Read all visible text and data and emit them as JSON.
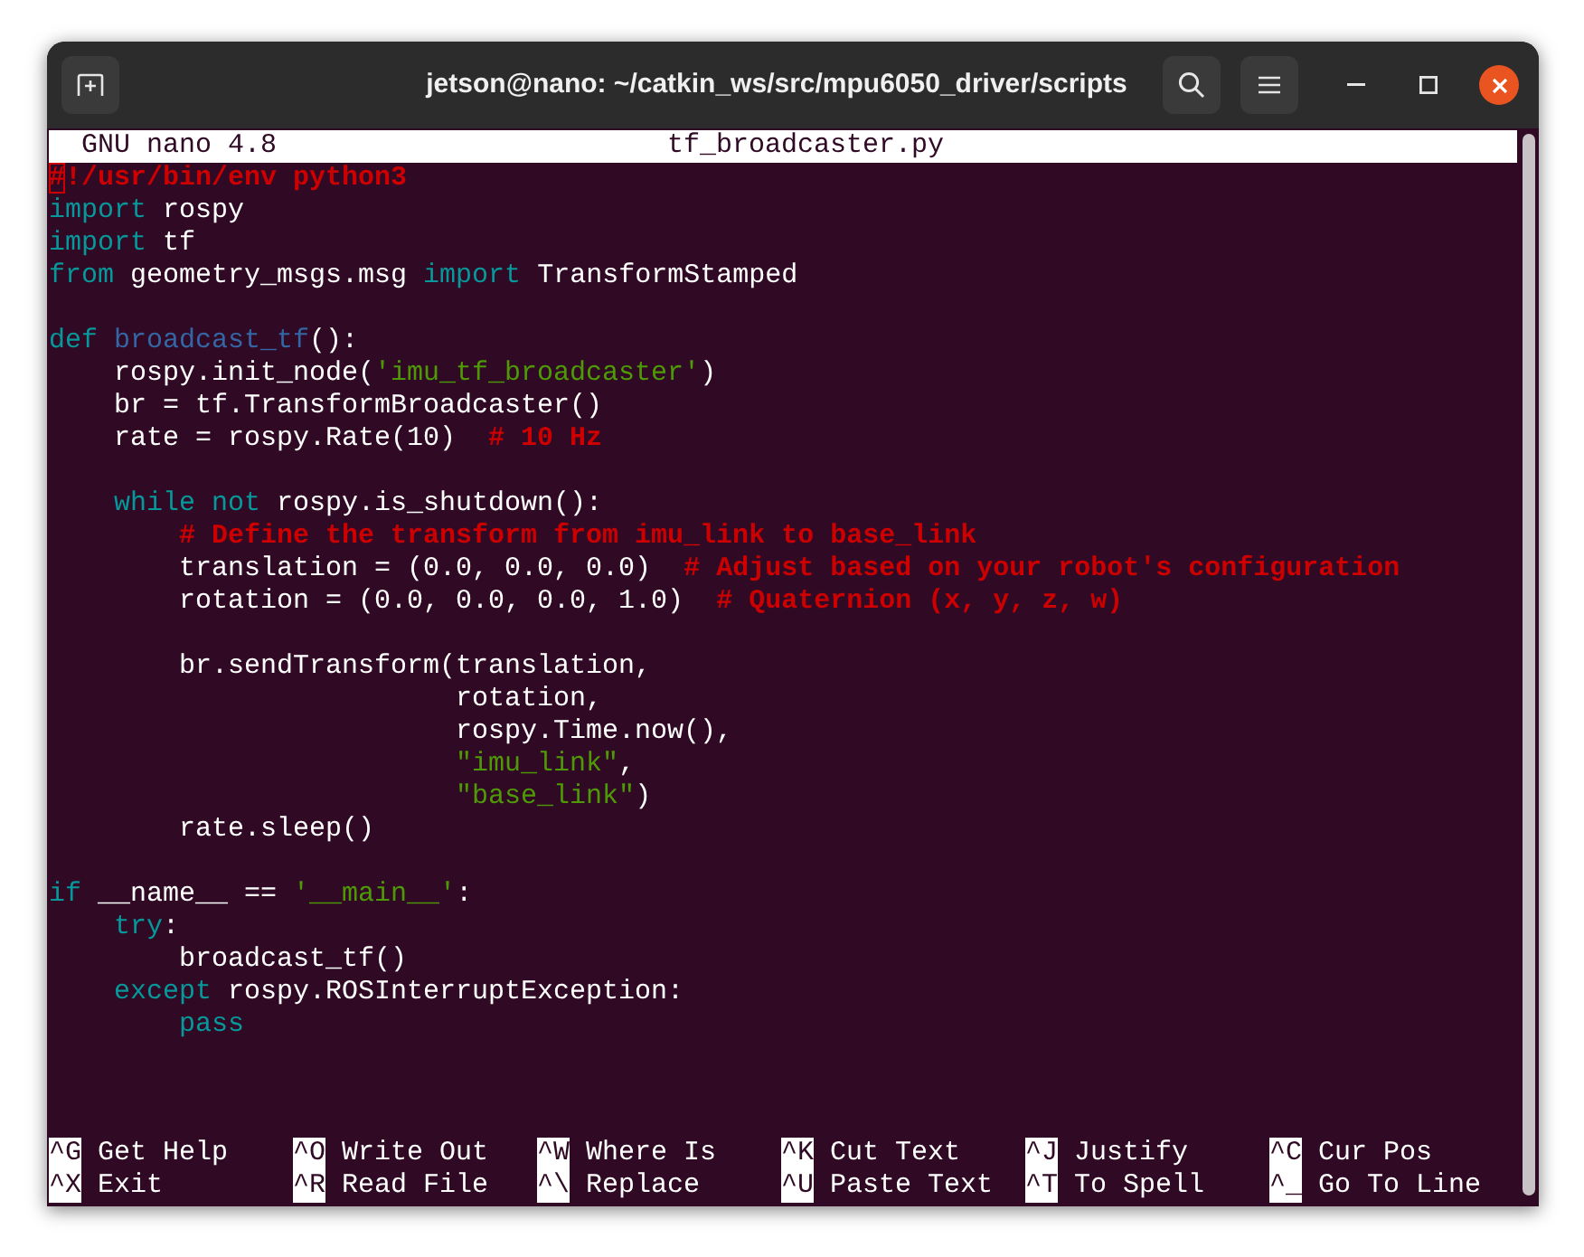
{
  "window": {
    "title": "jetson@nano: ~/catkin_ws/src/mpu6050_driver/scripts"
  },
  "editor": {
    "version": "GNU nano 4.8",
    "filename": "tf_broadcaster.py",
    "lines": [
      {
        "kind": "code",
        "segments": [
          {
            "kind": "cursor",
            "text": "#"
          },
          {
            "kind": "comment",
            "text": "!/usr/bin/env python3"
          }
        ]
      },
      {
        "kind": "code",
        "segments": [
          {
            "kind": "keyword",
            "text": "import"
          },
          {
            "kind": "plain",
            "text": " rospy"
          }
        ]
      },
      {
        "kind": "code",
        "segments": [
          {
            "kind": "keyword",
            "text": "import"
          },
          {
            "kind": "plain",
            "text": " tf"
          }
        ]
      },
      {
        "kind": "code",
        "segments": [
          {
            "kind": "keyword",
            "text": "from"
          },
          {
            "kind": "plain",
            "text": " geometry_msgs.msg "
          },
          {
            "kind": "keyword",
            "text": "import"
          },
          {
            "kind": "plain",
            "text": " TransformStamped"
          }
        ]
      },
      {
        "kind": "blank"
      },
      {
        "kind": "code",
        "segments": [
          {
            "kind": "keyword",
            "text": "def"
          },
          {
            "kind": "function",
            "text": " broadcast_tf"
          },
          {
            "kind": "plain",
            "text": "():"
          }
        ]
      },
      {
        "kind": "code",
        "segments": [
          {
            "kind": "plain",
            "text": "    rospy.init_node("
          },
          {
            "kind": "string",
            "text": "'imu_tf_broadcaster'"
          },
          {
            "kind": "plain",
            "text": ")"
          }
        ]
      },
      {
        "kind": "code",
        "segments": [
          {
            "kind": "plain",
            "text": "    br = tf.TransformBroadcaster()"
          }
        ]
      },
      {
        "kind": "code",
        "segments": [
          {
            "kind": "plain",
            "text": "    rate = rospy.Rate(10)  "
          },
          {
            "kind": "comment",
            "text": "# 10 Hz"
          }
        ]
      },
      {
        "kind": "blank"
      },
      {
        "kind": "code",
        "segments": [
          {
            "kind": "keyword",
            "text": "    while not"
          },
          {
            "kind": "plain",
            "text": " rospy.is_shutdown():"
          }
        ]
      },
      {
        "kind": "code",
        "segments": [
          {
            "kind": "comment",
            "text": "        # Define the transform from imu_link to base_link"
          }
        ]
      },
      {
        "kind": "code",
        "segments": [
          {
            "kind": "plain",
            "text": "        translation = (0.0, 0.0, 0.0)  "
          },
          {
            "kind": "comment",
            "text": "# Adjust based on your robot's configuration"
          }
        ]
      },
      {
        "kind": "code",
        "segments": [
          {
            "kind": "plain",
            "text": "        rotation = (0.0, 0.0, 0.0, 1.0)  "
          },
          {
            "kind": "comment",
            "text": "# Quaternion (x, y, z, w)"
          }
        ]
      },
      {
        "kind": "blank"
      },
      {
        "kind": "code",
        "segments": [
          {
            "kind": "plain",
            "text": "        br.sendTransform(translation,"
          }
        ]
      },
      {
        "kind": "code",
        "segments": [
          {
            "kind": "plain",
            "text": "                         rotation,"
          }
        ]
      },
      {
        "kind": "code",
        "segments": [
          {
            "kind": "plain",
            "text": "                         rospy.Time.now(),"
          }
        ]
      },
      {
        "kind": "code",
        "segments": [
          {
            "kind": "string",
            "text": "                         \"imu_link\""
          },
          {
            "kind": "plain",
            "text": ","
          }
        ]
      },
      {
        "kind": "code",
        "segments": [
          {
            "kind": "string",
            "text": "                         \"base_link\""
          },
          {
            "kind": "plain",
            "text": ")"
          }
        ]
      },
      {
        "kind": "code",
        "segments": [
          {
            "kind": "plain",
            "text": "        rate.sleep()"
          }
        ]
      },
      {
        "kind": "blank"
      },
      {
        "kind": "code",
        "segments": [
          {
            "kind": "keyword",
            "text": "if"
          },
          {
            "kind": "plain",
            "text": " __name__ == "
          },
          {
            "kind": "string",
            "text": "'__main__'"
          },
          {
            "kind": "plain",
            "text": ":"
          }
        ]
      },
      {
        "kind": "code",
        "segments": [
          {
            "kind": "keyword",
            "text": "    try"
          },
          {
            "kind": "plain",
            "text": ":"
          }
        ]
      },
      {
        "kind": "code",
        "segments": [
          {
            "kind": "plain",
            "text": "        broadcast_tf()"
          }
        ]
      },
      {
        "kind": "code",
        "segments": [
          {
            "kind": "keyword",
            "text": "    except"
          },
          {
            "kind": "plain",
            "text": " rospy.ROSInterruptException:"
          }
        ]
      },
      {
        "kind": "code",
        "segments": [
          {
            "kind": "keyword",
            "text": "        pass"
          }
        ]
      }
    ],
    "shortcuts": [
      [
        {
          "key": "^G",
          "label": "Get Help"
        },
        {
          "key": "^O",
          "label": "Write Out"
        },
        {
          "key": "^W",
          "label": "Where Is"
        },
        {
          "key": "^K",
          "label": "Cut Text"
        },
        {
          "key": "^J",
          "label": "Justify"
        },
        {
          "key": "^C",
          "label": "Cur Pos"
        }
      ],
      [
        {
          "key": "^X",
          "label": "Exit"
        },
        {
          "key": "^R",
          "label": "Read File"
        },
        {
          "key": "^\\",
          "label": "Replace"
        },
        {
          "key": "^U",
          "label": "Paste Text"
        },
        {
          "key": "^T",
          "label": "To Spell"
        },
        {
          "key": "^_",
          "label": "Go To Line"
        }
      ]
    ]
  }
}
